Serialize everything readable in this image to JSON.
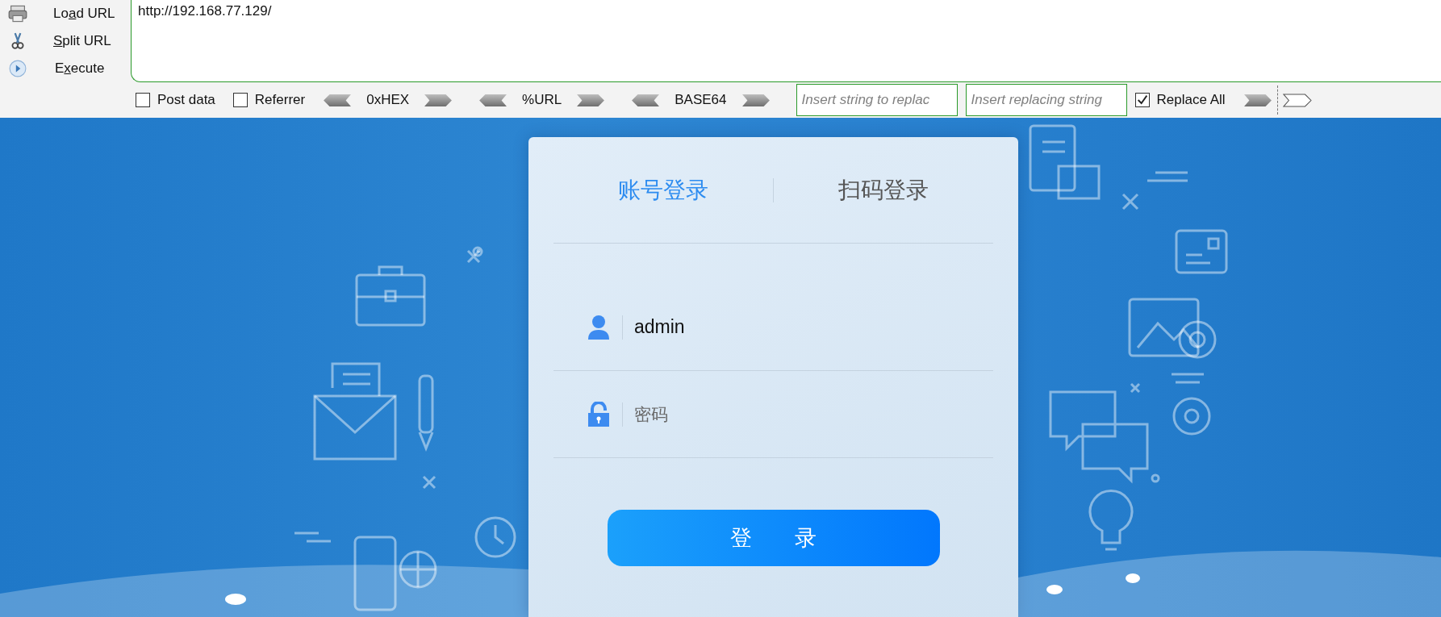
{
  "toolbar": {
    "actions": [
      {
        "kind": "load",
        "label_before": "Lo",
        "access_key": "a",
        "label_after": "d URL"
      },
      {
        "kind": "split",
        "access_key": "S",
        "label_after": "plit URL"
      },
      {
        "kind": "execute",
        "label_before": "E",
        "access_key": "x",
        "label_after": "ecute"
      }
    ],
    "url": "http://192.168.77.129/",
    "options": [
      {
        "label": "Post data",
        "checked": false
      },
      {
        "label": "Referrer",
        "checked": false
      }
    ],
    "encoders": [
      "0xHEX",
      "%URL",
      "BASE64"
    ],
    "replace_from": {
      "placeholder": "Insert string to replac"
    },
    "replace_to": {
      "placeholder": "Insert replacing string"
    },
    "replace_all": {
      "label": "Replace All",
      "checked": true
    }
  },
  "login": {
    "tabs": [
      {
        "label": "账号登录",
        "selected": true
      },
      {
        "label": "扫码登录",
        "selected": false
      }
    ],
    "username": {
      "value": "admin"
    },
    "password": {
      "placeholder": "密码"
    },
    "submit": "登 录"
  }
}
